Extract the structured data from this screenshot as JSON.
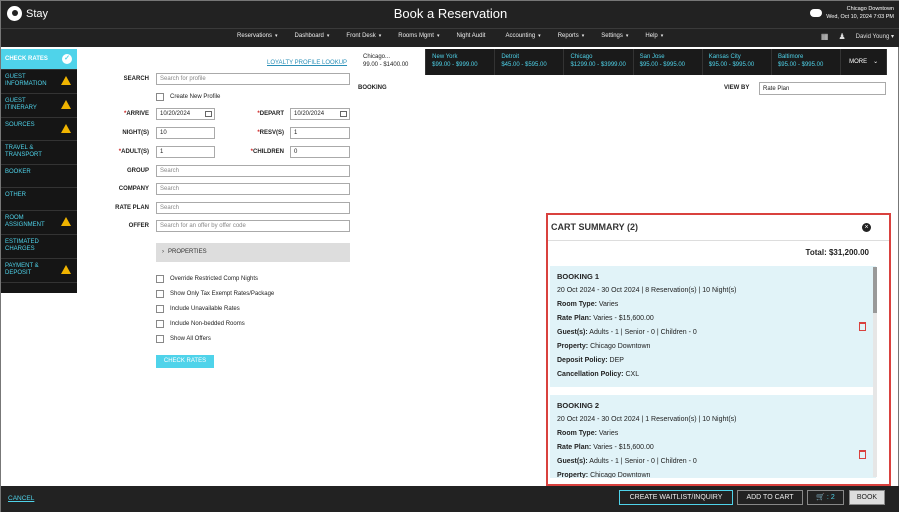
{
  "header": {
    "logo_text": "Stay",
    "title": "Book a Reservation",
    "location": "Chicago Downtown",
    "datetime": "Wed, Oct 10, 2024 7:03 PM",
    "weather_icon": "cloud-icon"
  },
  "menu": {
    "items": [
      "Reservations",
      "Dashboard",
      "Front Desk",
      "Rooms Mgmt",
      "Night Audit",
      "Accounting",
      "Reports",
      "Settings",
      "Help"
    ],
    "carets": [
      "▾",
      "▾",
      "▾",
      "▾",
      "",
      "▾",
      "▾",
      "▾",
      "▾"
    ],
    "user": "David Young",
    "calc_icon": "calculator-icon",
    "bell_icon": "bell-icon"
  },
  "nav": {
    "items": [
      {
        "label": "CHECK RATES",
        "state": "active"
      },
      {
        "label": "GUEST INFORMATION",
        "state": "warn"
      },
      {
        "label": "GUEST ITINERARY",
        "state": "warn"
      },
      {
        "label": "SOURCES",
        "state": "warn"
      },
      {
        "label": "TRAVEL & TRANSPORT",
        "state": ""
      },
      {
        "label": "BOOKER",
        "state": ""
      },
      {
        "label": "OTHER",
        "state": ""
      },
      {
        "label": "ROOM ASSIGNMENT",
        "state": "warn"
      },
      {
        "label": "ESTIMATED CHARGES",
        "state": ""
      },
      {
        "label": "PAYMENT & DEPOSIT",
        "state": "warn"
      }
    ],
    "accent": "#4fd3ea",
    "warn_color": "#f0b400"
  },
  "form": {
    "search_label": "SEARCH",
    "search_placeholder": "Search for profile",
    "loyalty_link": "LOYALTY PROFILE LOOKUP",
    "create_profile": "Create New Profile",
    "arrive_label": "ARRIVE",
    "arrive_value": "10/20/2024",
    "depart_label": "DEPART",
    "depart_value": "10/20/2024",
    "nights_label": "NIGHT(S)",
    "nights_value": "10",
    "resv_label": "RESV(S)",
    "resv_value": "1",
    "adults_label": "ADULT(S)",
    "adults_value": "1",
    "children_label": "CHILDREN",
    "children_value": "0",
    "group_label": "GROUP",
    "group_placeholder": "Search",
    "company_label": "COMPANY",
    "company_placeholder": "Search",
    "rateplan_label": "RATE PLAN",
    "rateplan_placeholder": "Search",
    "offer_label": "OFFER",
    "offer_placeholder": "Search for an offer by offer code",
    "properties_label": "PROPERTIES",
    "options": [
      "Override Restricted Comp Nights",
      "Show Only Tax Exempt Rates/Package",
      "Include Unavailable Rates",
      "Include Non-bedded Rooms",
      "Show All Offers"
    ],
    "check_rates_button": "CHECK RATES"
  },
  "tabs": {
    "items": [
      {
        "name": "Chicago...",
        "range": "99.00 - $1400.00"
      },
      {
        "name": "New York",
        "range": "$99.00 - $999.00"
      },
      {
        "name": "Detroit",
        "range": "$45.00 - $595.00"
      },
      {
        "name": "Chicago",
        "range": "$1299.00 - $3999.00"
      },
      {
        "name": "San Jose",
        "range": "$95.00 - $995.00"
      },
      {
        "name": "Kansas City",
        "range": "$95.00 - $995.00"
      },
      {
        "name": "Baltimore",
        "range": "$95.00 - $995.00"
      }
    ],
    "more_label": "MORE",
    "booking_label": "BOOKING",
    "viewby_label": "VIEW BY",
    "viewby_value": "Rate Plan"
  },
  "cart": {
    "title": "CART SUMMARY (2)",
    "total": "Total: $31,200.00",
    "bookings": [
      {
        "title": "BOOKING 1",
        "summary": "20 Oct 2024 - 30 Oct 2024 | 8 Reservation(s) | 10 Night(s)",
        "room_type_label": "Room Type:",
        "room_type": "Varies",
        "rate_plan_label": "Rate Plan:",
        "rate_plan": "Varies - $15,600.00",
        "guests_label": "Guest(s):",
        "guests": "Adults - 1 | Senior - 0 | Children - 0",
        "property_label": "Property:",
        "property": "Chicago Downtown",
        "deposit_label": "Deposit Policy:",
        "deposit": "DEP",
        "cancel_label": "Cancellation Policy:",
        "cancel": "CXL"
      },
      {
        "title": "BOOKING 2",
        "summary": "20 Oct 2024 - 30 Oct 2024 | 1 Reservation(s) | 10 Night(s)",
        "room_type_label": "Room Type:",
        "room_type": "Varies",
        "rate_plan_label": "Rate Plan:",
        "rate_plan": "Varies - $15,600.00",
        "guests_label": "Guest(s):",
        "guests": "Adults - 1 | Senior - 0 | Children - 0",
        "property_label": "Property:",
        "property": "Chicago Downtown"
      }
    ]
  },
  "footer": {
    "cancel": "CANCEL",
    "waitlist": "CREATE WAITLIST/INQUIRY",
    "add_to_cart": "ADD TO CART",
    "cart_count": "2",
    "book": "BOOK"
  }
}
